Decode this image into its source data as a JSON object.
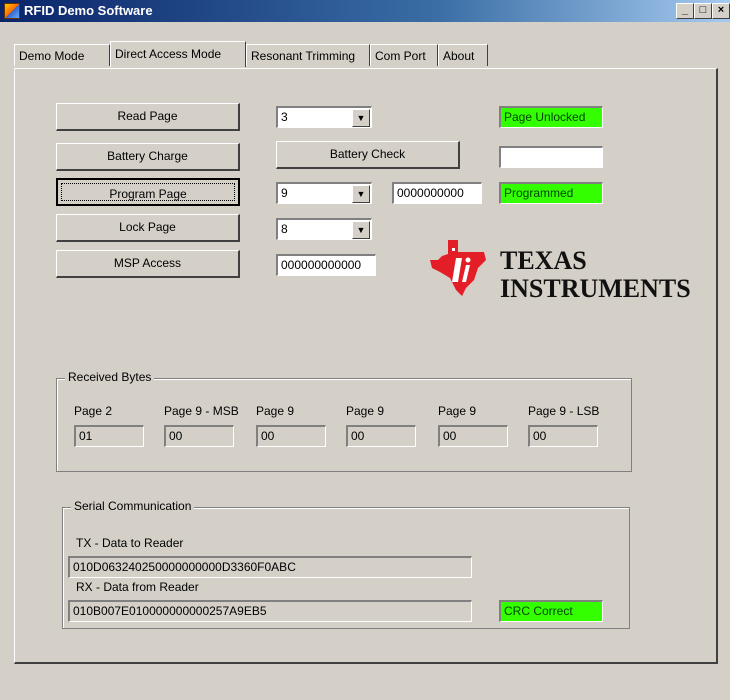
{
  "window": {
    "title": "RFID Demo Software",
    "minimize": "_",
    "maximize": "□",
    "close": "×"
  },
  "tabs": [
    {
      "label": "Demo Mode"
    },
    {
      "label": "Direct Access Mode",
      "active": true
    },
    {
      "label": "Resonant Trimming"
    },
    {
      "label": "Com Port"
    },
    {
      "label": "About"
    }
  ],
  "controls": {
    "read_page": {
      "button": "Read Page",
      "page_select": "3",
      "status": "Page Unlocked"
    },
    "battery": {
      "charge_button": "Battery Charge",
      "check_button": "Battery Check",
      "result": ""
    },
    "program": {
      "button": "Program Page",
      "page_select": "9",
      "data": "0000000000",
      "status": "Programmed"
    },
    "lock": {
      "button": "Lock Page",
      "page_select": "8"
    },
    "msp": {
      "button": "MSP Access",
      "data": "000000000000"
    }
  },
  "logo": {
    "line1": "Texas",
    "line2": "Instruments"
  },
  "received_bytes": {
    "title": "Received Bytes",
    "items": [
      {
        "label": "Page 2",
        "value": "01"
      },
      {
        "label": "Page 9 - MSB",
        "value": "00"
      },
      {
        "label": "Page 9",
        "value": "00"
      },
      {
        "label": "Page 9",
        "value": "00"
      },
      {
        "label": "Page 9",
        "value": "00"
      },
      {
        "label": "Page 9 - LSB",
        "value": "00"
      }
    ]
  },
  "serial": {
    "title": "Serial Communication",
    "tx_label": "TX - Data to Reader",
    "tx_value": "010D063240250000000000D3360F0ABC",
    "rx_label": "RX - Data from Reader",
    "rx_value": "010B007E010000000000257A9EB5",
    "crc_status": "CRC Correct"
  },
  "colors": {
    "status_green": "#33ff00",
    "title_blue": "#0a246a",
    "logo_red": "#e41e26"
  }
}
